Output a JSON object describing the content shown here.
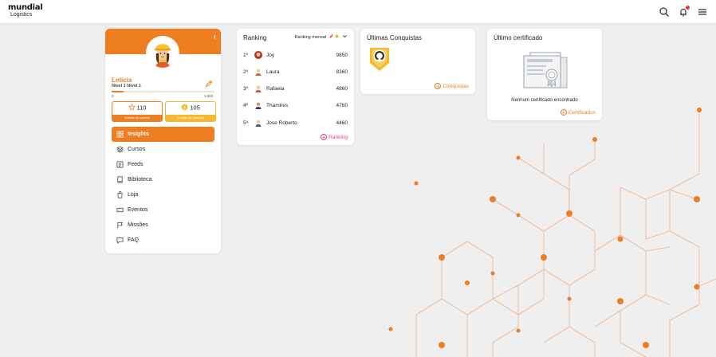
{
  "header": {
    "logo_line1": "mundial",
    "logo_line2": "Logistics",
    "icons": [
      "search-icon",
      "bell-icon",
      "menu-icon"
    ]
  },
  "profile": {
    "name": "Letícia",
    "level": "Nível 1 Nível 1",
    "progress_min": "0",
    "progress_max": "1.000",
    "progress_fraction": 0.12,
    "points": "110",
    "points_caption": "Extrato de pontos",
    "coins": "105",
    "coins_caption": "Extrato de moedas"
  },
  "menu": [
    {
      "label": "Insights",
      "icon": "grid-icon",
      "active": true
    },
    {
      "label": "Cursos",
      "icon": "layers-icon",
      "active": false
    },
    {
      "label": "Feeds",
      "icon": "feed-icon",
      "active": false
    },
    {
      "label": "Biblioteca",
      "icon": "book-icon",
      "active": false
    },
    {
      "label": "Loja",
      "icon": "cart-icon",
      "active": false
    },
    {
      "label": "Eventos",
      "icon": "ticket-icon",
      "active": false
    },
    {
      "label": "Missões",
      "icon": "flag-icon",
      "active": false
    },
    {
      "label": "FAQ",
      "icon": "chat-icon",
      "active": false
    }
  ],
  "ranking": {
    "title": "Ranking",
    "selector": "Ranking mensal",
    "link": "Ranking",
    "rows": [
      {
        "pos": "1º",
        "name": "Joy",
        "score": "9850"
      },
      {
        "pos": "2º",
        "name": "Laura",
        "score": "8360"
      },
      {
        "pos": "3º",
        "name": "Rafaela",
        "score": "4860"
      },
      {
        "pos": "4º",
        "name": "Thamires",
        "score": "4760"
      },
      {
        "pos": "5º",
        "name": "Jose Roberto",
        "score": "4460"
      }
    ]
  },
  "conquistas": {
    "title": "Últimas Conquistas",
    "link": "Conquistas"
  },
  "certificado": {
    "title": "Último certificado",
    "empty": "Nenhum certificado encontrado",
    "link": "Certificados"
  },
  "colors": {
    "accent": "#ef7d22",
    "pink": "#e84470",
    "gold": "#f5b82e"
  }
}
